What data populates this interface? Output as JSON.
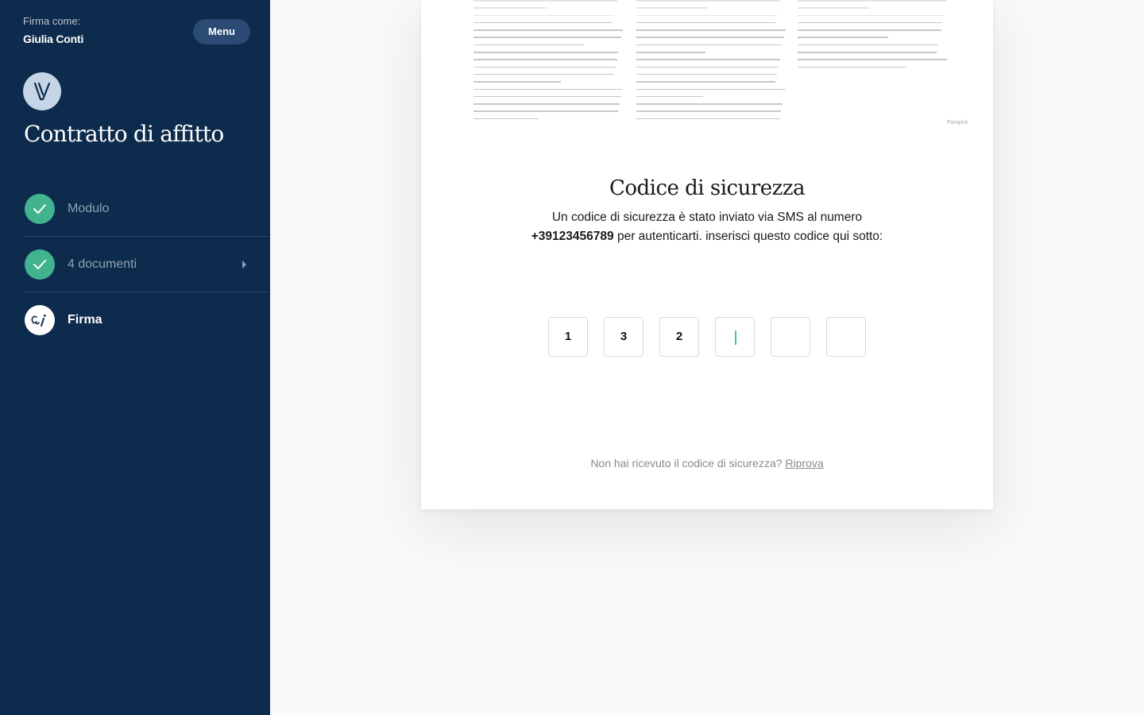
{
  "sidebar": {
    "signer_label": "Firma come:",
    "signer_name": "Giulia Conti",
    "menu_label": "Menu",
    "document_title": "Contratto di affitto",
    "steps": [
      {
        "label": "Modulo",
        "status": "completed",
        "icon": "check-icon"
      },
      {
        "label": "4 documenti",
        "status": "completed",
        "icon": "check-icon"
      },
      {
        "label": "Firma",
        "status": "active",
        "icon": "signature-icon"
      }
    ]
  },
  "document_preview": {
    "paraphe": "Paraphe"
  },
  "security_code": {
    "title": "Codice di sicurezza",
    "description_line1": "Un codice di sicurezza è stato inviato via SMS al numero",
    "phone": "+39123456789",
    "description_line2": " per autenticarti. inserisci questo codice qui sotto:",
    "digits": [
      "1",
      "3",
      "2",
      "",
      "",
      ""
    ],
    "focused_index": 3,
    "resend_prompt": "Non hai ricevuto il codice di sicurezza? ",
    "resend_link": "Riprova"
  },
  "colors": {
    "sidebar_bg": "#0d2b4c",
    "accent_green": "#41b38f",
    "menu_button": "#2b4a74",
    "cursor": "#41c7a5"
  }
}
